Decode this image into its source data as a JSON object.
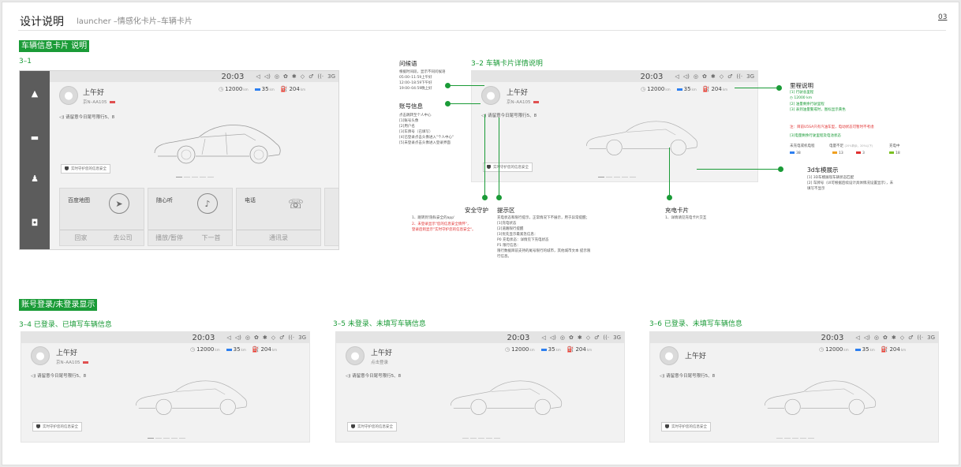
{
  "header": {
    "title": "设计说明",
    "subtitle": "launcher –情感化卡片–车辆卡片",
    "page_no": "03"
  },
  "section1": {
    "tag": "车辆信息卡片 说明",
    "s31": "3–1",
    "s32": "3–2 车辆卡片详情说明"
  },
  "section2": {
    "tag": "账号登录/未登录显示",
    "s34": "3–4 已登录、已填写车辆信息",
    "s35": "3–5 未登录、未填写车辆信息",
    "s36": "3–6 已登录、未填写车辆信息"
  },
  "status": {
    "time": "20:03",
    "icons": [
      "nav-icon",
      "volume-icon",
      "steering-icon",
      "fan-icon",
      "bluetooth-icon",
      "wifi-icon",
      "settings-icon",
      "signal-icon",
      "4g-icon"
    ],
    "glyphs": [
      "◁",
      "◁)",
      "◎",
      "✿",
      "✱",
      "◇",
      "♂",
      "((·",
      "3G"
    ]
  },
  "card": {
    "greeting": "上午好",
    "plate": "京N–AA105",
    "login_hint": "点击登录",
    "mileage": "12000",
    "mileage_unit": "km",
    "battery": "35",
    "battery_unit": "km",
    "range": "204",
    "range_unit": "km",
    "notice": "请留意今日尾号限行5、8",
    "security": "实时守护您的信息安全"
  },
  "apps": [
    {
      "name": "百度地图",
      "icon": "compass-icon",
      "glyph": "➤",
      "actions": [
        "回家",
        "去公司"
      ]
    },
    {
      "name": "随心听",
      "icon": "music-icon",
      "glyph": "♪",
      "actions": [
        "播放/暂停",
        "下一首"
      ]
    },
    {
      "name": "电话",
      "icon": "phone-icon",
      "glyph": "☏",
      "actions": [
        "通讯录"
      ]
    }
  ],
  "sidebar": {
    "items": [
      {
        "name": "home-icon",
        "glyph": "▲"
      },
      {
        "name": "car-icon",
        "glyph": "▬"
      },
      {
        "name": "user-icon",
        "glyph": "♟"
      },
      {
        "name": "app-icon",
        "glyph": "◘"
      }
    ]
  },
  "annotations": {
    "greet_title": "问候语",
    "greet_body": "根据时间段，显示不同问候语\n05:00–11:59上午好\n12:00–18:59下午好\n19:00–04:59晚上好",
    "account_title": "账号信息",
    "account_body": "点击跳转至个人中心\n[1]账号头像\n[2]用户名\n[3]车牌号（已填写）\n[4]已登录点击头像进入\"个人中心\"\n[5]未登录点击头像进入登录界面",
    "safety_title": "安全守护",
    "safety_body1": "1、跳转到'隐私安全的app'",
    "safety_body2": "2、未登录显示\"您的信息安全情怀\"，\n登录后则显示\"实时守护您的信息安全\"。",
    "tip_title": "提示区",
    "tip_body": "充电状态和限行提示，正常情况下不展示，用于异常提醒；\n[1]充电状态\n[2]道路限行提醒\n[3]优先显示最紧急信息：\nP0 充电状态：详情见下充电状态\nP1 限行信息：\n限行数据目前支持的尾号限行的城市，其他城市文本 提示限\n行信息。",
    "charge_title": "充电卡片",
    "charge_body": "1、详情请见充电卡片交互",
    "mileage_title": "里程说明",
    "mileage_body1": "[1] 行驶总里程",
    "mileage_body_v": "12000",
    "mileage_body_u": "km",
    "mileage_body2": "[2] 油量剩余行驶里程\n[3] 表到油量警戒时，图标显示黄色",
    "mileage_warn": "注：目前U5SA只有汽油车型，电动状态可暂时不考虑",
    "mileage_ev": "[3]电量剩余行驶里程及电池状态",
    "ev_labels": [
      "未充电或机电程",
      "电量不足",
      "充电中"
    ],
    "ev_label_note": "(20%剩余，20%以下)",
    "ev_values": [
      "38",
      "13",
      "3",
      "18"
    ],
    "model_title": "3d车模展示",
    "model_body": "[1] 3D车模展现车辆状态匹配\n[2] 车牌号（UI可根据后续设计具体情况设置显示），未\n填写不显示"
  }
}
